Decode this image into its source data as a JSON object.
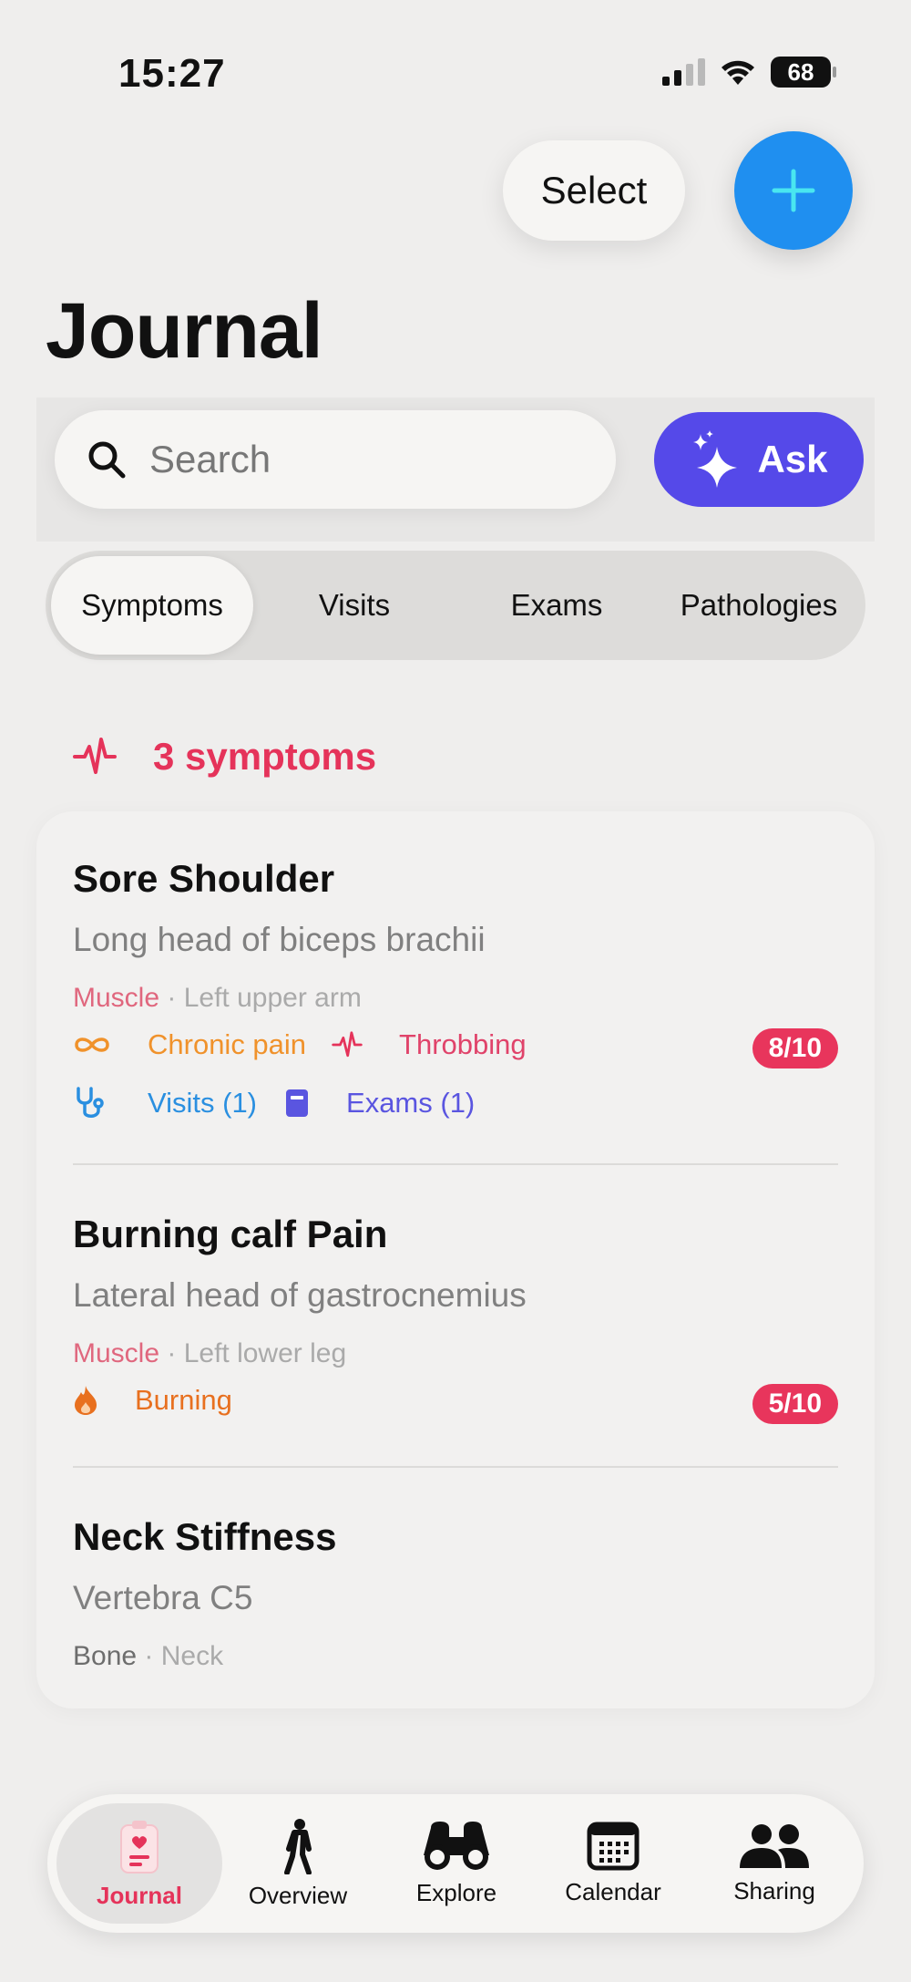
{
  "status": {
    "time": "15:27",
    "battery": "68"
  },
  "header": {
    "select_label": "Select",
    "title": "Journal"
  },
  "search": {
    "placeholder": "Search",
    "ask_label": "Ask"
  },
  "tabs": [
    {
      "label": "Symptoms",
      "active": true
    },
    {
      "label": "Visits",
      "active": false
    },
    {
      "label": "Exams",
      "active": false
    },
    {
      "label": "Pathologies",
      "active": false
    }
  ],
  "section": {
    "count_label": "3 symptoms"
  },
  "symptoms": [
    {
      "title": "Sore Shoulder",
      "subtitle": "Long head of biceps brachii",
      "type": "Muscle",
      "location": "Left upper arm",
      "tag1": "Chronic pain",
      "tag2": "Throbbing",
      "severity": "8/10",
      "visits": "Visits (1)",
      "exams": "Exams (1)"
    },
    {
      "title": "Burning calf Pain",
      "subtitle": "Lateral head of gastrocnemius",
      "type": "Muscle",
      "location": "Left lower leg",
      "tag1": "Burning",
      "severity": "5/10"
    },
    {
      "title": "Neck Stiffness",
      "subtitle": "Vertebra C5",
      "type": "Bone",
      "location": "Neck"
    }
  ],
  "tabbar": [
    {
      "label": "Journal",
      "icon": "journal-icon",
      "active": true
    },
    {
      "label": "Overview",
      "icon": "person-icon"
    },
    {
      "label": "Explore",
      "icon": "binoculars-icon"
    },
    {
      "label": "Calendar",
      "icon": "calendar-icon"
    },
    {
      "label": "Sharing",
      "icon": "people-icon"
    }
  ],
  "colors": {
    "accent_red": "#e5335a",
    "accent_blue": "#1f8ff0",
    "ask_purple": "#5549e9",
    "chronic_orange": "#f0922b",
    "visits_blue": "#2a8fe0",
    "exams_indigo": "#5a55e0",
    "burning_orange": "#e8701f"
  }
}
